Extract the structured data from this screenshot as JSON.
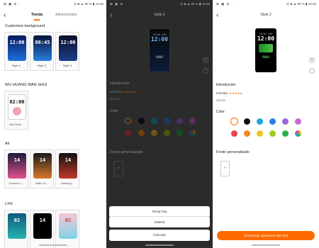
{
  "status": {
    "icons": "⊠ ▣ ⊕ ·",
    "right": "⊘ ◈ ▲ 90 % ▮ 12:46"
  },
  "phone1": {
    "tabs": {
      "store": "Tienda",
      "admin": "Administrador"
    },
    "sections": [
      {
        "title": "Customize background"
      },
      {
        "title": "WU HUANG WAN SHUI"
      },
      {
        "title": "Ali"
      },
      {
        "title": "LXH"
      }
    ],
    "customize_cards": [
      {
        "label": "Style 1",
        "time": "12:00"
      },
      {
        "label": "Style 2",
        "time": "06:45"
      },
      {
        "label": "Style 3",
        "time": "12:00"
      }
    ],
    "wu_cards": [
      {
        "label": "WU HUA...",
        "time": "02:00"
      }
    ],
    "ali_cards": [
      {
        "label": "Cuckoo C...",
        "time": "14"
      },
      {
        "label": "Little Ch...",
        "time": "14"
      },
      {
        "label": "Dancing...",
        "time": "14"
      }
    ],
    "lxh_cards": [
      {
        "label": "",
        "time": "02"
      },
      {
        "label": "",
        "time": "14"
      },
      {
        "label": "",
        "time": "02"
      }
    ]
  },
  "detail": {
    "title": "Style 3",
    "intro": "Introducción",
    "stars_label": "Estrellas:",
    "stars": "★★★★★",
    "author": "Nebula",
    "color": "Color",
    "custom_bg": "Fondo personalizado",
    "add": "+",
    "watch": {
      "date": "10/06 SAB",
      "time": "12:00",
      "line1": "8000"
    },
    "colors_row1": [
      "#ffffff",
      "#111111",
      "#17a9d6",
      "#2a7fe0",
      "#9c6ad8",
      "#c86ad6"
    ],
    "colors_row2": [
      "#e8414b",
      "#f0881b",
      "#f2c41b",
      "#9ccc1f",
      "#25b04b",
      "rainbow"
    ]
  },
  "sheet": {
    "take_photo": "Tomar foto",
    "gallery": "Galería",
    "cancel": "Cancelar"
  },
  "sync_button": "Sincronizar apariencia del reloj"
}
